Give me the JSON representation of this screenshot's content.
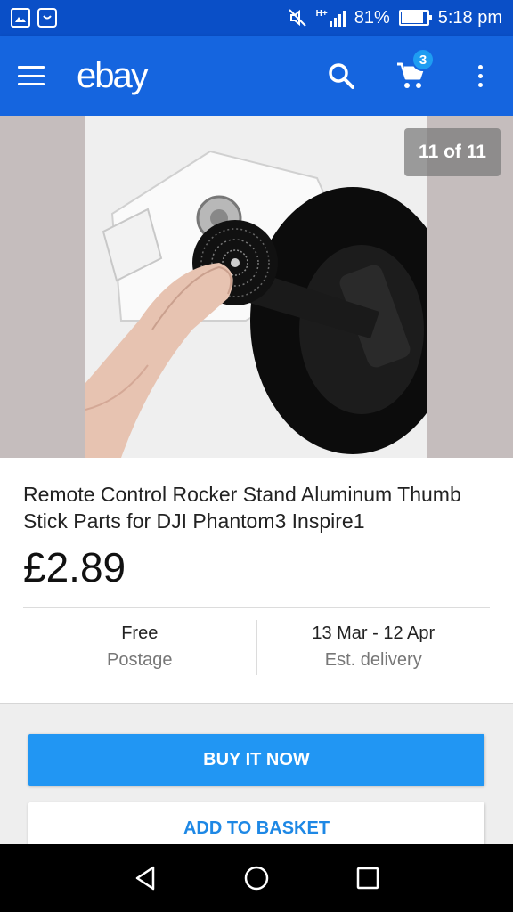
{
  "status_bar": {
    "battery_percent": "81%",
    "battery_level": 0.81,
    "time": "5:18 pm",
    "signal_label": "H+"
  },
  "app_bar": {
    "logo": "ebay",
    "cart_count": "3",
    "icons": [
      "menu-icon",
      "search-icon",
      "cart-icon",
      "more-vert-icon"
    ]
  },
  "gallery": {
    "counter": "11 of 11"
  },
  "listing": {
    "title": "Remote Control Rocker Stand Aluminum Thumb Stick Parts for DJI Phantom3 Inspire1",
    "price": "£2.89",
    "postage_value": "Free",
    "postage_label": "Postage",
    "delivery_value": "13 Mar - 12 Apr",
    "delivery_label": "Est. delivery"
  },
  "buttons": {
    "buy_now": "BUY IT NOW",
    "add_to_basket": "ADD TO BASKET"
  },
  "colors": {
    "status_bar": "#0a4fc7",
    "app_bar": "#1565df",
    "buy_button": "#2196f3",
    "basket_text": "#1e88e5",
    "badge": "#1e9df2"
  }
}
